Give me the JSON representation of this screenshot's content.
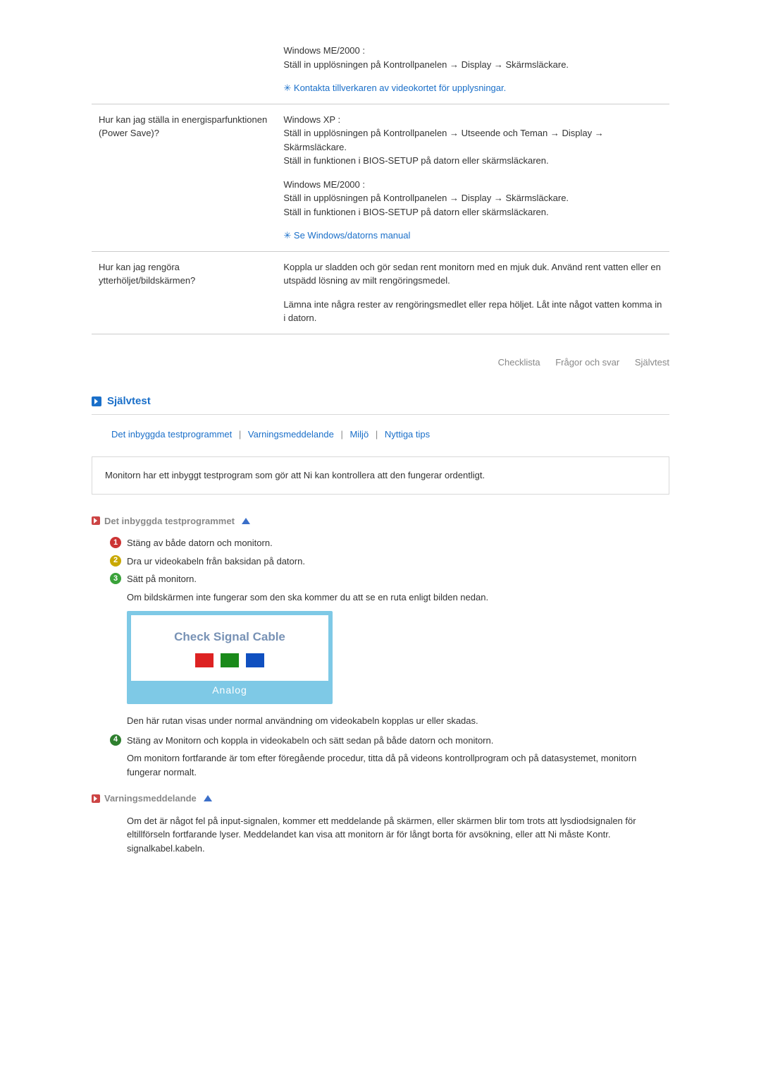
{
  "faq": [
    {
      "answers_only": true,
      "answers": [
        {
          "text": "Windows ME/2000 :\nStäll in upplösningen på Kontrollpanelen → Display → Skärmsläckare."
        },
        {
          "note": "Kontakta tillverkaren av videokortet för upplysningar."
        }
      ]
    },
    {
      "q": "Hur kan jag ställa in energisparfunktionen (Power Save)?",
      "answers": [
        {
          "text": "Windows XP :\nStäll in upplösningen på Kontrollpanelen → Utseende och Teman → Display → Skärmsläckare.\nStäll in funktionen i BIOS-SETUP på datorn eller skärmsläckaren."
        },
        {
          "text": "Windows ME/2000 :\nStäll in upplösningen på Kontrollpanelen → Display → Skärmsläckare.\nStäll in funktionen i BIOS-SETUP på datorn eller skärmsläckaren."
        },
        {
          "note": "Se Windows/datorns manual"
        }
      ]
    },
    {
      "q": "Hur kan jag rengöra ytterhöljet/bildskärmen?",
      "answers": [
        {
          "text": "Koppla ur sladden och gör sedan rent monitorn med en mjuk duk. Använd rent vatten eller en utspädd lösning av milt rengöringsmedel."
        },
        {
          "text": "Lämna inte några rester av rengöringsmedlet eller repa höljet. Låt inte något vatten komma in i datorn."
        }
      ]
    }
  ],
  "jump": {
    "l1": "Checklista",
    "l2": "Frågor och svar",
    "l3": "Självtest"
  },
  "section": {
    "title": "Självtest"
  },
  "ilinks": {
    "a": "Det inbyggda testprogrammet",
    "b": "Varningsmeddelande",
    "c": "Miljö",
    "d": "Nyttiga tips",
    "sep": "|"
  },
  "ibox": "Monitorn har ett inbyggt testprogram som gör att Ni kan kontrollera att den fungerar ordentligt.",
  "sub1": "Det inbyggda testprogrammet",
  "steps": {
    "s1": "Stäng av både datorn och monitorn.",
    "s2": "Dra ur videokabeln från baksidan på datorn.",
    "s3": "Sätt på monitorn.",
    "s3b": "Om bildskärmen inte fungerar som den ska kommer du att se en ruta enligt bilden nedan.",
    "s3c": "Den här rutan visas under normal användning om videokabeln kopplas ur eller skadas.",
    "s4": "Stäng av Monitorn och koppla in videokabeln och sätt sedan på både datorn och monitorn.",
    "s4b": "Om monitorn fortfarande är tom efter föregående procedur, titta då på videons kontrollprogram och på datasystemet, monitorn fungerar normalt."
  },
  "csc": {
    "title": "Check Signal Cable",
    "foot": "Analog"
  },
  "sub2": "Varningsmeddelande",
  "warn": "Om det är något fel på input-signalen, kommer ett meddelande på skärmen, eller skärmen blir tom trots att lysdiodsignalen för eltillförseln fortfarande lyser. Meddelandet kan visa att monitorn är för långt borta för avsökning, eller att Ni måste Kontr. signalkabel.kabeln."
}
